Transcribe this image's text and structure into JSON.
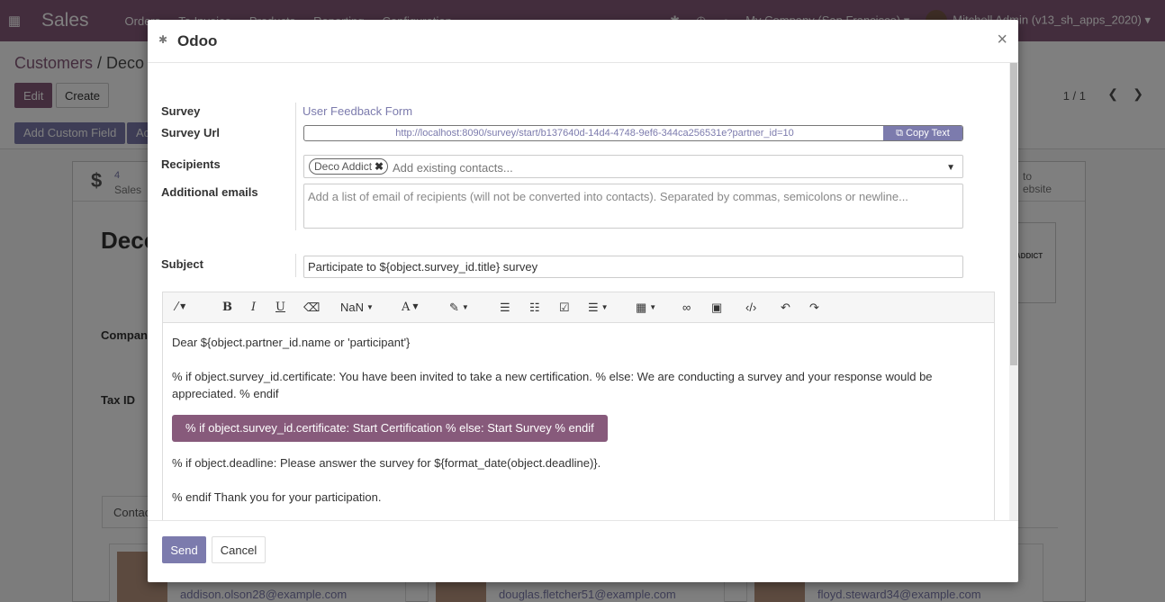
{
  "navbar": {
    "app_name": "Sales",
    "menu": [
      "Orders",
      "To Invoice",
      "Products",
      "Reporting",
      "Configuration"
    ],
    "company": "My Company (San Francisco)",
    "user": "Mitchell Admin (v13_sh_apps_2020)"
  },
  "control_panel": {
    "breadcrumb_root": "Customers",
    "breadcrumb_sep": " / ",
    "breadcrumb_current": "Deco",
    "edit_label": "Edit",
    "create_label": "Create",
    "pager": "1 / 1",
    "add_custom_field": "Add Custom Field",
    "add_custom_2": "Ac"
  },
  "form": {
    "stat_count": "4",
    "stat_label": "Sales",
    "stat_right": "to\nebsite",
    "customer_name": "Deco",
    "logo_text": "ADDICT",
    "company_label": "Company",
    "taxid_label": "Tax ID",
    "tab_contacts": "Contac",
    "contacts": [
      "addison.olson28@example.com",
      "douglas.fletcher51@example.com",
      "floyd.steward34@example.com"
    ]
  },
  "modal": {
    "title": "Odoo",
    "survey_label": "Survey",
    "survey_value": "User Feedback Form",
    "survey_url_label": "Survey Url",
    "survey_url": "http://localhost:8090/survey/start/b137640d-14d4-4748-9ef6-344ca256531e?partner_id=10",
    "copy_text": "Copy Text",
    "recipients_label": "Recipients",
    "recipient_tag": "Deco Addict",
    "recipients_placeholder": "Add existing contacts...",
    "additional_emails_label": "Additional emails",
    "additional_emails_placeholder": "Add a list of email of recipients (will not be converted into contacts). Separated by commas, semicolons or newline...",
    "subject_label": "Subject",
    "subject_value": "Participate to ${object.survey_id.title} survey",
    "toolbar": {
      "font_size": "NaN"
    },
    "body": {
      "line1": "Dear ${object.partner_id.name or 'participant'}",
      "line2": "% if object.survey_id.certificate: You have been invited to take a new certification. % else: We are conducting a survey and your response would be appreciated. % endif",
      "cta": "% if object.survey_id.certificate: Start Certification % else: Start Survey % endif",
      "line3": "% if object.deadline: Please answer the survey for ${format_date(object.deadline)}.",
      "line4": "% endif Thank you for your participation."
    },
    "send_label": "Send",
    "cancel_label": "Cancel"
  }
}
